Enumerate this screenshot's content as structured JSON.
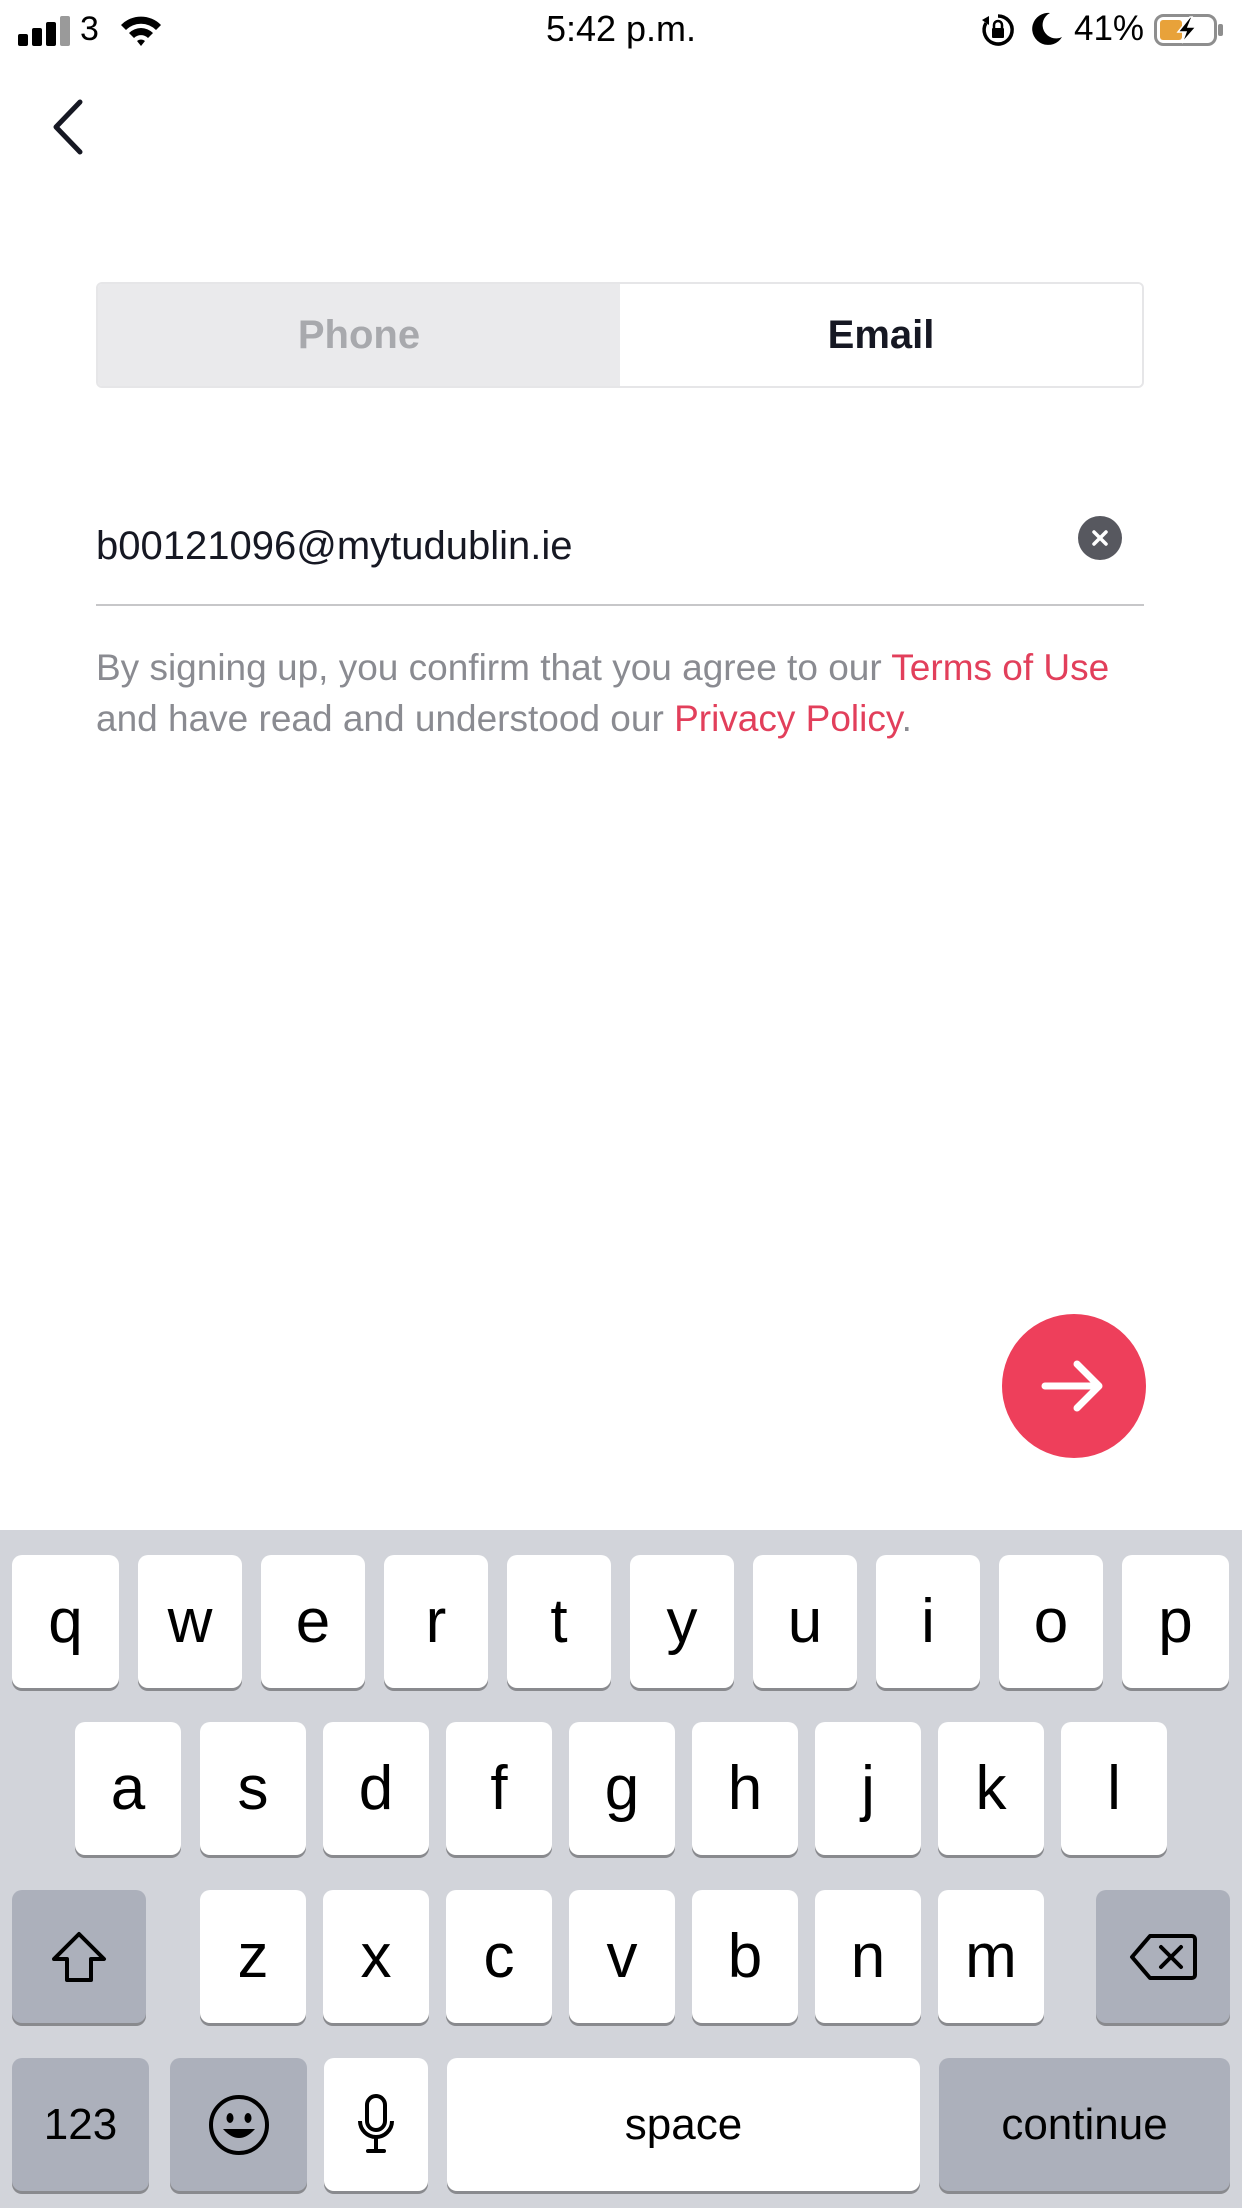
{
  "status_bar": {
    "carrier": "3",
    "time": "5:42 p.m.",
    "battery_percent": "41%",
    "icons": [
      "signal-icon",
      "wifi-icon",
      "orientation-lock-icon",
      "moon-icon",
      "battery-charging-icon"
    ]
  },
  "nav": {
    "back_icon": "chevron-left-icon"
  },
  "tabs": [
    {
      "label": "Phone",
      "selected": false
    },
    {
      "label": "Email",
      "selected": true
    }
  ],
  "email_field": {
    "value": "b00121096@mytudublin.ie",
    "clear_icon": "clear-icon"
  },
  "terms": {
    "prefix": "By signing up, you confirm that you agree to our ",
    "terms_link": "Terms of Use",
    "middle": " and have read and understood our ",
    "privacy_link": "Privacy Policy",
    "suffix": "."
  },
  "next_button": {
    "icon": "arrow-right-icon"
  },
  "colors": {
    "accent": "#EE3F5B",
    "link": "#E23F5B",
    "keyboard_bg": "#D2D4DA",
    "function_key": "#ACB0BB"
  },
  "keyboard": {
    "row1": [
      "q",
      "w",
      "e",
      "r",
      "t",
      "y",
      "u",
      "i",
      "o",
      "p"
    ],
    "row2": [
      "a",
      "s",
      "d",
      "f",
      "g",
      "h",
      "j",
      "k",
      "l"
    ],
    "row3": [
      "z",
      "x",
      "c",
      "v",
      "b",
      "n",
      "m"
    ],
    "numbers_label": "123",
    "space_label": "space",
    "continue_label": "continue",
    "shift_icon": "shift-icon",
    "delete_icon": "backspace-icon",
    "emoji_icon": "emoji-icon",
    "mic_icon": "microphone-icon"
  }
}
